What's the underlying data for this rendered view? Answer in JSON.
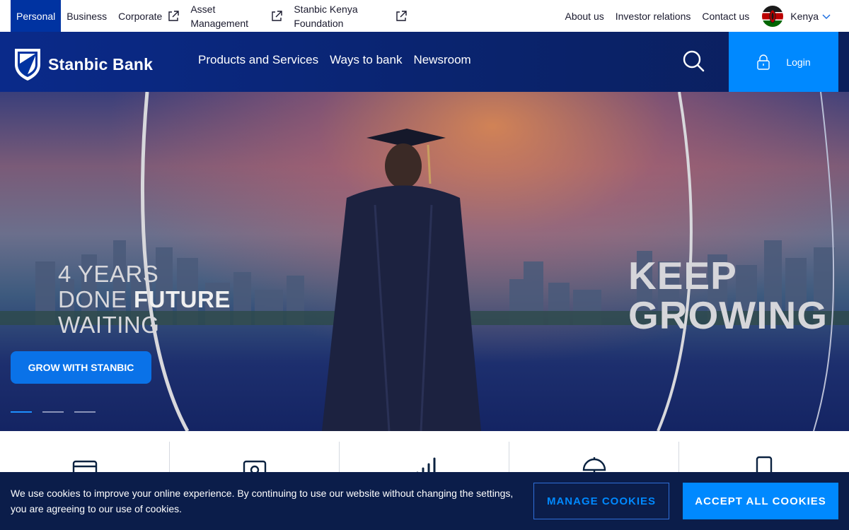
{
  "topbar": {
    "tabs": [
      {
        "label": "Personal",
        "active": true
      },
      {
        "label": "Business"
      },
      {
        "label": "Corporate",
        "external": true
      },
      {
        "label": "Asset Management",
        "external": true
      },
      {
        "label": "Stanbic Kenya Foundation",
        "external": true
      }
    ],
    "links": [
      "About us",
      "Investor relations",
      "Contact us"
    ],
    "country": "Kenya"
  },
  "header": {
    "brand": "Stanbic Bank",
    "nav": [
      "Products and Services",
      "Ways to bank",
      "Newsroom"
    ],
    "login_label": "Login"
  },
  "hero": {
    "slogan_left_line1": "4 YEARS",
    "slogan_left_line2_a": "DONE ",
    "slogan_left_line2_b": "FUTURE",
    "slogan_left_line3": "WAITING",
    "slogan_right_line1": "KEEP",
    "slogan_right_line2": "GROWING",
    "cta_label": "GROW WITH STANBIC",
    "slides": 3,
    "active_slide": 1
  },
  "quick_links": {
    "icons": [
      "card-icon",
      "wallet-icon",
      "bar-chart-icon",
      "umbrella-icon",
      "phone-icon"
    ]
  },
  "cookie": {
    "message": "We use cookies to improve your online experience. By continuing to use our website without changing the settings, you are agreeing to our use of cookies.",
    "manage_label": "MANAGE COOKIES",
    "accept_label": "ACCEPT ALL COOKIES"
  },
  "colors": {
    "brand_blue": "#0033a1",
    "accent_blue": "#0089ff",
    "cookie_bg": "#0b1d4a"
  }
}
